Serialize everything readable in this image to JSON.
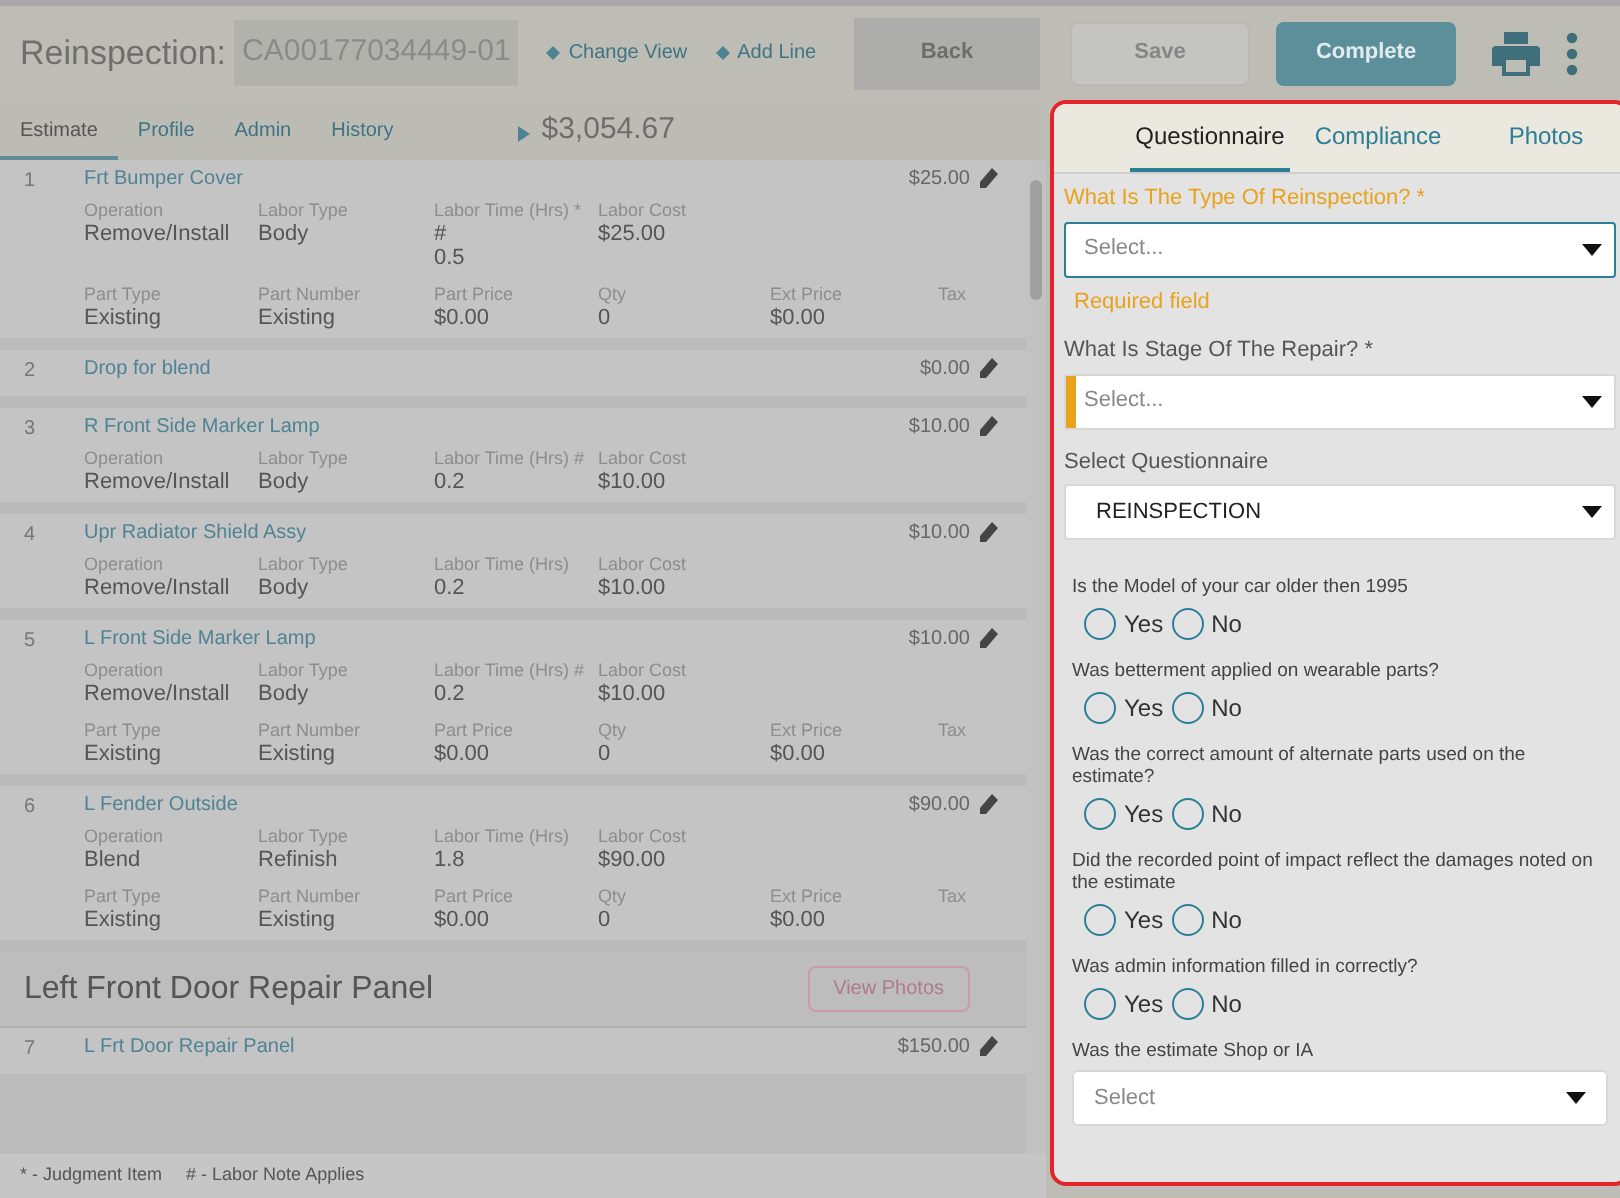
{
  "header": {
    "title": "Reinspection:",
    "claim_number": "CA00177034449-01",
    "links": [
      "Change View",
      "Add Line"
    ],
    "back_button": "Back",
    "save_button": "Save",
    "complete_button": "Complete"
  },
  "tabs": [
    {
      "label": "Estimate",
      "selected": true
    },
    {
      "label": "Profile",
      "selected": false
    },
    {
      "label": "Admin",
      "selected": false
    },
    {
      "label": "History",
      "selected": false
    }
  ],
  "total": "$3,054.67",
  "lines": [
    {
      "kind": "line",
      "number": "1",
      "title": "Frt Bumper Cover",
      "price": "$25.00",
      "fields": [
        {
          "label": "Operation",
          "value": "Remove/Install"
        },
        {
          "label": "Labor Type",
          "value": "Body"
        },
        {
          "label": "Labor Time (Hrs) *",
          "value": "#\n0.5"
        },
        {
          "label": "Labor Cost",
          "value": "$25.00"
        }
      ],
      "part_fields": [
        {
          "label": "Part Type",
          "value": "Existing"
        },
        {
          "label": "Part Number",
          "value": "Existing"
        },
        {
          "label": "Part Price",
          "value": "$0.00"
        },
        {
          "label": "Qty",
          "value": "0"
        },
        {
          "label": "Ext Price",
          "value": "$0.00"
        },
        {
          "label": "Tax"
        }
      ]
    },
    {
      "kind": "line",
      "number": "2",
      "title": "Drop for blend",
      "price": "$0.00"
    },
    {
      "kind": "line",
      "number": "3",
      "title": "R Front Side Marker Lamp",
      "price": "$10.00",
      "fields": [
        {
          "label": "Operation",
          "value": "Remove/Install"
        },
        {
          "label": "Labor Type",
          "value": "Body"
        },
        {
          "label": "Labor Time (Hrs) #",
          "value": "0.2"
        },
        {
          "label": "Labor Cost",
          "value": "$10.00"
        }
      ]
    },
    {
      "kind": "line",
      "number": "4",
      "title": "Upr Radiator Shield Assy",
      "price": "$10.00",
      "fields": [
        {
          "label": "Operation",
          "value": "Remove/Install"
        },
        {
          "label": "Labor Type",
          "value": "Body"
        },
        {
          "label": "Labor Time (Hrs)",
          "value": "0.2"
        },
        {
          "label": "Labor Cost",
          "value": "$10.00"
        }
      ]
    },
    {
      "kind": "line",
      "number": "5",
      "title": "L Front Side Marker Lamp",
      "price": "$10.00",
      "fields": [
        {
          "label": "Operation",
          "value": "Remove/Install"
        },
        {
          "label": "Labor Type",
          "value": "Body"
        },
        {
          "label": "Labor Time (Hrs) #",
          "value": "0.2"
        },
        {
          "label": "Labor Cost",
          "value": "$10.00"
        }
      ],
      "part_fields": [
        {
          "label": "Part Type",
          "value": "Existing"
        },
        {
          "label": "Part Number",
          "value": "Existing"
        },
        {
          "label": "Part Price",
          "value": "$0.00"
        },
        {
          "label": "Qty",
          "value": "0"
        },
        {
          "label": "Ext Price",
          "value": "$0.00"
        },
        {
          "label": "Tax"
        }
      ]
    },
    {
      "kind": "line",
      "number": "6",
      "title": "L Fender Outside",
      "price": "$90.00",
      "fields": [
        {
          "label": "Operation",
          "value": "Blend"
        },
        {
          "label": "Labor Type",
          "value": "Refinish"
        },
        {
          "label": "Labor Time (Hrs)",
          "value": "1.8"
        },
        {
          "label": "Labor Cost",
          "value": "$90.00"
        }
      ],
      "part_fields": [
        {
          "label": "Part Type",
          "value": "Existing"
        },
        {
          "label": "Part Number",
          "value": "Existing"
        },
        {
          "label": "Part Price",
          "value": "$0.00"
        },
        {
          "label": "Qty",
          "value": "0"
        },
        {
          "label": "Ext Price",
          "value": "$0.00"
        },
        {
          "label": "Tax"
        }
      ]
    },
    {
      "kind": "section",
      "title": "Left Front Door Repair Panel",
      "button": "View Photos"
    },
    {
      "kind": "line",
      "number": "7",
      "title": "L Frt Door Repair Panel",
      "price": "$150.00"
    }
  ],
  "legend": [
    "* - Judgment Item",
    "# - Labor Note Applies"
  ],
  "panel": {
    "tabs": [
      {
        "label": "Questionnaire",
        "selected": true
      },
      {
        "label": "Compliance",
        "selected": false
      },
      {
        "label": "Photos",
        "selected": false
      }
    ],
    "fields": [
      {
        "label": "What Is The Type Of Reinspection? *",
        "placeholder": "Select...",
        "focused": true,
        "flagged": false,
        "error": "Required field"
      },
      {
        "label": "What Is Stage Of The Repair? *",
        "placeholder": "Select...",
        "focused": false,
        "flagged": true
      },
      {
        "label": "Select Questionnaire",
        "value": "REINSPECTION",
        "focused": false,
        "flagged": false
      }
    ],
    "questions": [
      {
        "kind": "radio",
        "text": "Is the Model of your car older then 1995",
        "options": [
          {
            "label": "Yes",
            "selected": false
          },
          {
            "label": "No",
            "selected": false
          }
        ]
      },
      {
        "kind": "radio",
        "text": "Was betterment applied on wearable parts?",
        "options": [
          {
            "label": "Yes",
            "selected": false
          },
          {
            "label": "No",
            "selected": false
          }
        ]
      },
      {
        "kind": "radio",
        "text": "Was the correct amount of alternate parts used on the estimate?",
        "options": [
          {
            "label": "Yes",
            "selected": false
          },
          {
            "label": "No",
            "selected": false
          }
        ]
      },
      {
        "kind": "radio",
        "text": "Did the recorded point of impact reflect the damages noted on the estimate",
        "options": [
          {
            "label": "Yes",
            "selected": false
          },
          {
            "label": "No",
            "selected": false
          }
        ]
      },
      {
        "kind": "radio",
        "text": "Was admin information filled in correctly?",
        "options": [
          {
            "label": "Yes",
            "selected": false
          },
          {
            "label": "No",
            "selected": false
          }
        ]
      },
      {
        "kind": "select",
        "text": "Was the estimate Shop or IA",
        "placeholder": "Select"
      }
    ]
  }
}
